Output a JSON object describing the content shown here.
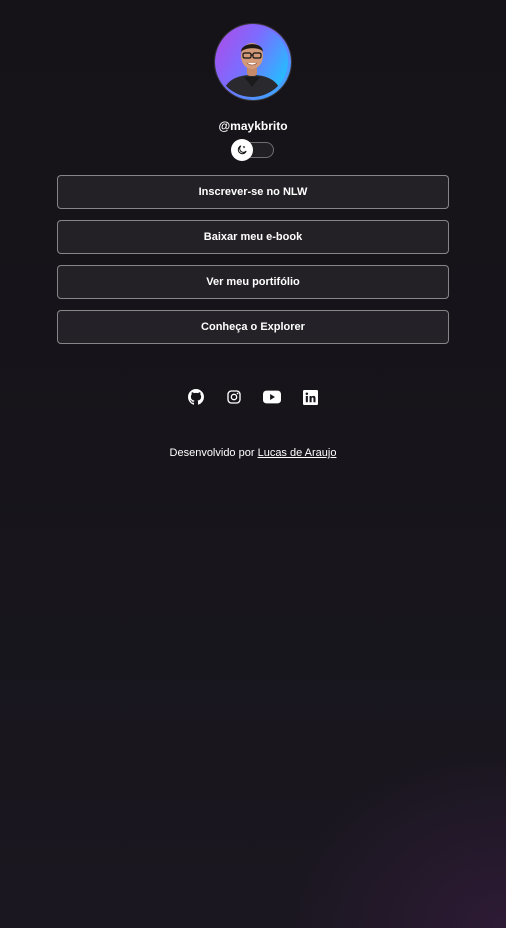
{
  "profile": {
    "username": "@maykbrito",
    "avatar_alt": "Mayk Brito"
  },
  "theme_switch": {
    "icon": "moon-icon"
  },
  "links": [
    {
      "label": "Inscrever-se no NLW"
    },
    {
      "label": "Baixar meu e-book"
    },
    {
      "label": "Ver meu portifólio"
    },
    {
      "label": "Conheça o Explorer"
    }
  ],
  "socials": [
    {
      "icon": "github-icon"
    },
    {
      "icon": "instagram-icon"
    },
    {
      "icon": "youtube-icon"
    },
    {
      "icon": "linkedin-icon"
    }
  ],
  "footer": {
    "prefix": "Desenvolvido por",
    "author_link": "Lucas de Araujo"
  },
  "colors": {
    "background": "#151317",
    "accent_gradient_start": "#a450e8",
    "accent_gradient_end": "#2fb5ff",
    "text": "#ffffff"
  }
}
